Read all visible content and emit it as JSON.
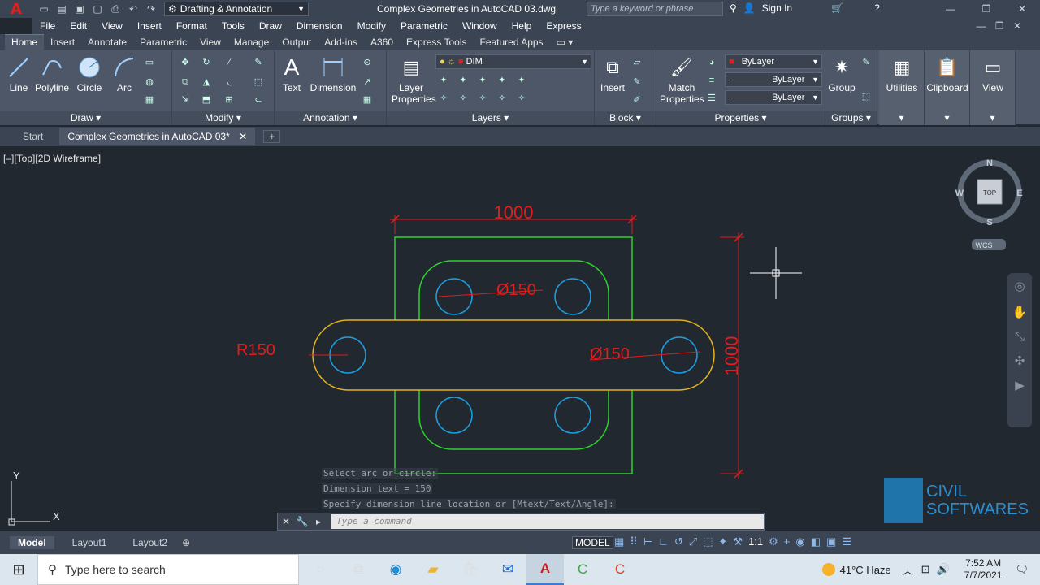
{
  "app": {
    "logo": "A",
    "workspace": "Drafting & Annotation",
    "doc_title": "Complex Geometries in AutoCAD 03.dwg",
    "search_placeholder": "Type a keyword or phrase",
    "sign_in": "Sign In"
  },
  "menu": [
    "File",
    "Edit",
    "View",
    "Insert",
    "Format",
    "Tools",
    "Draw",
    "Dimension",
    "Modify",
    "Parametric",
    "Window",
    "Help",
    "Express"
  ],
  "ribbon_tabs": [
    "Home",
    "Insert",
    "Annotate",
    "Parametric",
    "View",
    "Manage",
    "Output",
    "Add-ins",
    "A360",
    "Express Tools",
    "Featured Apps"
  ],
  "ribbon": {
    "draw": {
      "title": "Draw",
      "line": "Line",
      "polyline": "Polyline",
      "circle": "Circle",
      "arc": "Arc"
    },
    "modify": {
      "title": "Modify"
    },
    "annotation": {
      "title": "Annotation",
      "text": "Text",
      "dimension": "Dimension"
    },
    "layers": {
      "title": "Layers",
      "layer_properties": "Layer Properties",
      "current_layer": "DIM"
    },
    "block": {
      "title": "Block",
      "insert": "Insert"
    },
    "properties": {
      "title": "Properties",
      "match_properties": "Match Properties",
      "color": "ByLayer",
      "linetype": "ByLayer",
      "lineweight": "ByLayer"
    },
    "groups": {
      "title": "Groups",
      "group": "Group"
    },
    "utilities": "Utilities",
    "clipboard": "Clipboard",
    "view": "View"
  },
  "file_tabs": {
    "start": "Start",
    "active": "Complex Geometries in AutoCAD 03*"
  },
  "viewport": {
    "label": "[–][Top][2D Wireframe]"
  },
  "drawing": {
    "dim_top": "1000",
    "dim_right": "1000",
    "dia_upper": "Ø150",
    "dia_right": "Ø150",
    "radius": "R150"
  },
  "viewcube": {
    "n": "N",
    "s": "S",
    "e": "E",
    "w": "W",
    "top": "TOP",
    "wcs": "WCS"
  },
  "ucs": {
    "x": "X",
    "y": "Y"
  },
  "command": {
    "history": [
      "Select arc or circle:",
      "Dimension text = 150",
      "Specify dimension line location or [Mtext/Text/Angle]:"
    ],
    "placeholder": "Type a command"
  },
  "layouts": [
    "Model",
    "Layout1",
    "Layout2"
  ],
  "status": {
    "model": "MODEL",
    "scale": "1:1"
  },
  "watermark": {
    "line1": "CIVIL",
    "line2": "SOFTWARES"
  },
  "taskbar": {
    "search_placeholder": "Type here to search",
    "weather": "41°C  Haze",
    "time": "7:52 AM",
    "date": "7/7/2021"
  },
  "colors": {
    "dim_red": "#e01e1e",
    "green": "#2fd12f",
    "yellow": "#e3b31c",
    "cyan": "#1e9ee0"
  }
}
